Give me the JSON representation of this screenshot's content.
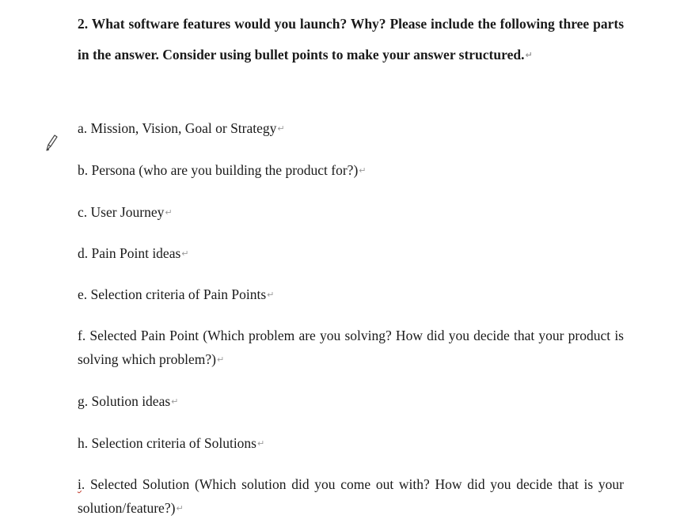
{
  "question": {
    "text": "2. What software features would you launch? Why? Please include the following three parts in the answer. Consider using bullet points to make your answer structured.",
    "para_mark": "↵"
  },
  "items": [
    {
      "text": "a. Mission, Vision, Goal or Strategy"
    },
    {
      "text": "b. Persona (who are you building the product for?)"
    },
    {
      "text": "c. User Journey"
    },
    {
      "text": "d. Pain Point ideas"
    },
    {
      "text": "e. Selection criteria of Pain Points"
    },
    {
      "text": "f. Selected Pain Point (Which problem are you solving? How did you decide that your product is solving which problem?)"
    },
    {
      "text": "g. Solution ideas"
    },
    {
      "text": "h. Selection criteria of Solutions"
    },
    {
      "prefix": "i",
      "text": ". Selected Solution (Which solution did you come out with? How did you decide that is your solution/feature?)"
    }
  ],
  "para_mark": "↵",
  "icons": {
    "cursor": "pencil-cursor-icon"
  }
}
